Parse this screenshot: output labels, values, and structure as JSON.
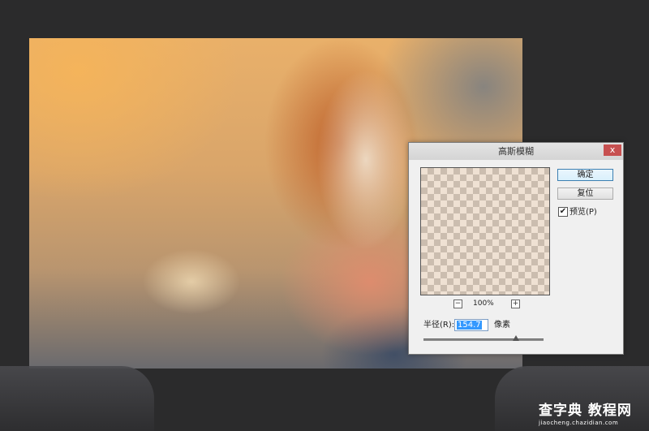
{
  "dialog": {
    "title": "高斯模糊",
    "close_label": "x",
    "ok_label": "确定",
    "reset_label": "复位",
    "preview_checkbox": {
      "label": "预览(P)",
      "checked": true,
      "mark": "✔"
    },
    "zoom": {
      "minus": "−",
      "value": "100%",
      "plus": "+"
    },
    "radius": {
      "label": "半径(R):",
      "value": "154.7",
      "unit": "像素",
      "slider_fraction": 0.77
    }
  },
  "watermark": {
    "text": "查字典 教程网",
    "sub": "jiaocheng.chazidian.com"
  },
  "colors": {
    "background": "#2b2b2c",
    "dialog_bg": "#f0f0f0",
    "close_red": "#c75050",
    "selection": "#3399ff"
  }
}
